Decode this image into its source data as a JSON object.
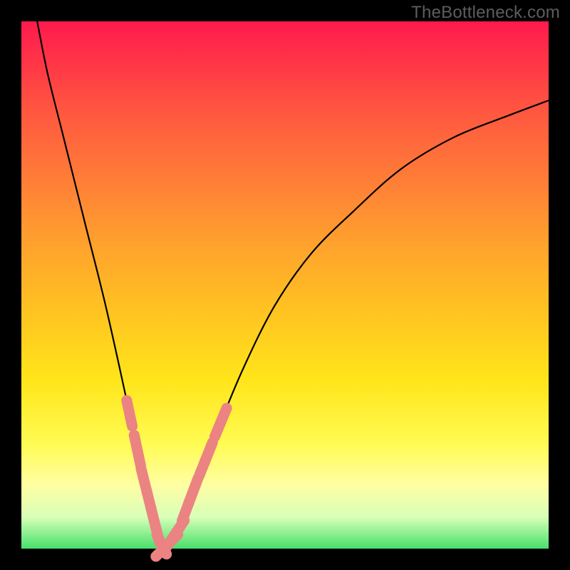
{
  "watermark": "TheBottleneck.com",
  "colors": {
    "page_bg": "#000000",
    "gradient_top": "#ff1a4d",
    "gradient_bottom": "#48e06b",
    "curve": "#000000",
    "marker": "#eb8383"
  },
  "chart_data": {
    "type": "line",
    "title": "",
    "xlabel": "",
    "ylabel": "",
    "xlim": [
      0,
      100
    ],
    "ylim": [
      0,
      100
    ],
    "grid": false,
    "series": [
      {
        "name": "curve",
        "x": [
          3,
          5,
          8,
          12,
          16,
          20,
          23,
          25,
          26,
          27,
          28,
          30,
          33,
          37,
          42,
          48,
          55,
          63,
          72,
          82,
          92,
          100
        ],
        "y": [
          100,
          90,
          78,
          62,
          46,
          28,
          14,
          6,
          2,
          0,
          1,
          4,
          12,
          22,
          34,
          46,
          56,
          64,
          72,
          78,
          82,
          85
        ]
      }
    ],
    "markers": {
      "name": "highlight-points",
      "shape": "rounded-capsule",
      "points": [
        {
          "x": 20.5,
          "y": 26,
          "len": 1.6
        },
        {
          "x": 22.0,
          "y": 20,
          "len": 1.8
        },
        {
          "x": 23.3,
          "y": 14,
          "len": 1.6
        },
        {
          "x": 24.2,
          "y": 10,
          "len": 1.2
        },
        {
          "x": 25.0,
          "y": 6,
          "len": 1.4
        },
        {
          "x": 25.8,
          "y": 3,
          "len": 1.2
        },
        {
          "x": 26.6,
          "y": 1,
          "len": 1.4
        },
        {
          "x": 27.6,
          "y": 0,
          "len": 1.8
        },
        {
          "x": 28.8,
          "y": 1,
          "len": 1.4
        },
        {
          "x": 30.0,
          "y": 4,
          "len": 1.2
        },
        {
          "x": 31.2,
          "y": 7,
          "len": 1.4
        },
        {
          "x": 32.6,
          "y": 11,
          "len": 1.6
        },
        {
          "x": 34.3,
          "y": 16,
          "len": 1.2
        },
        {
          "x": 35.5,
          "y": 19,
          "len": 1.4
        },
        {
          "x": 37.8,
          "y": 24,
          "len": 1.8
        }
      ]
    }
  }
}
